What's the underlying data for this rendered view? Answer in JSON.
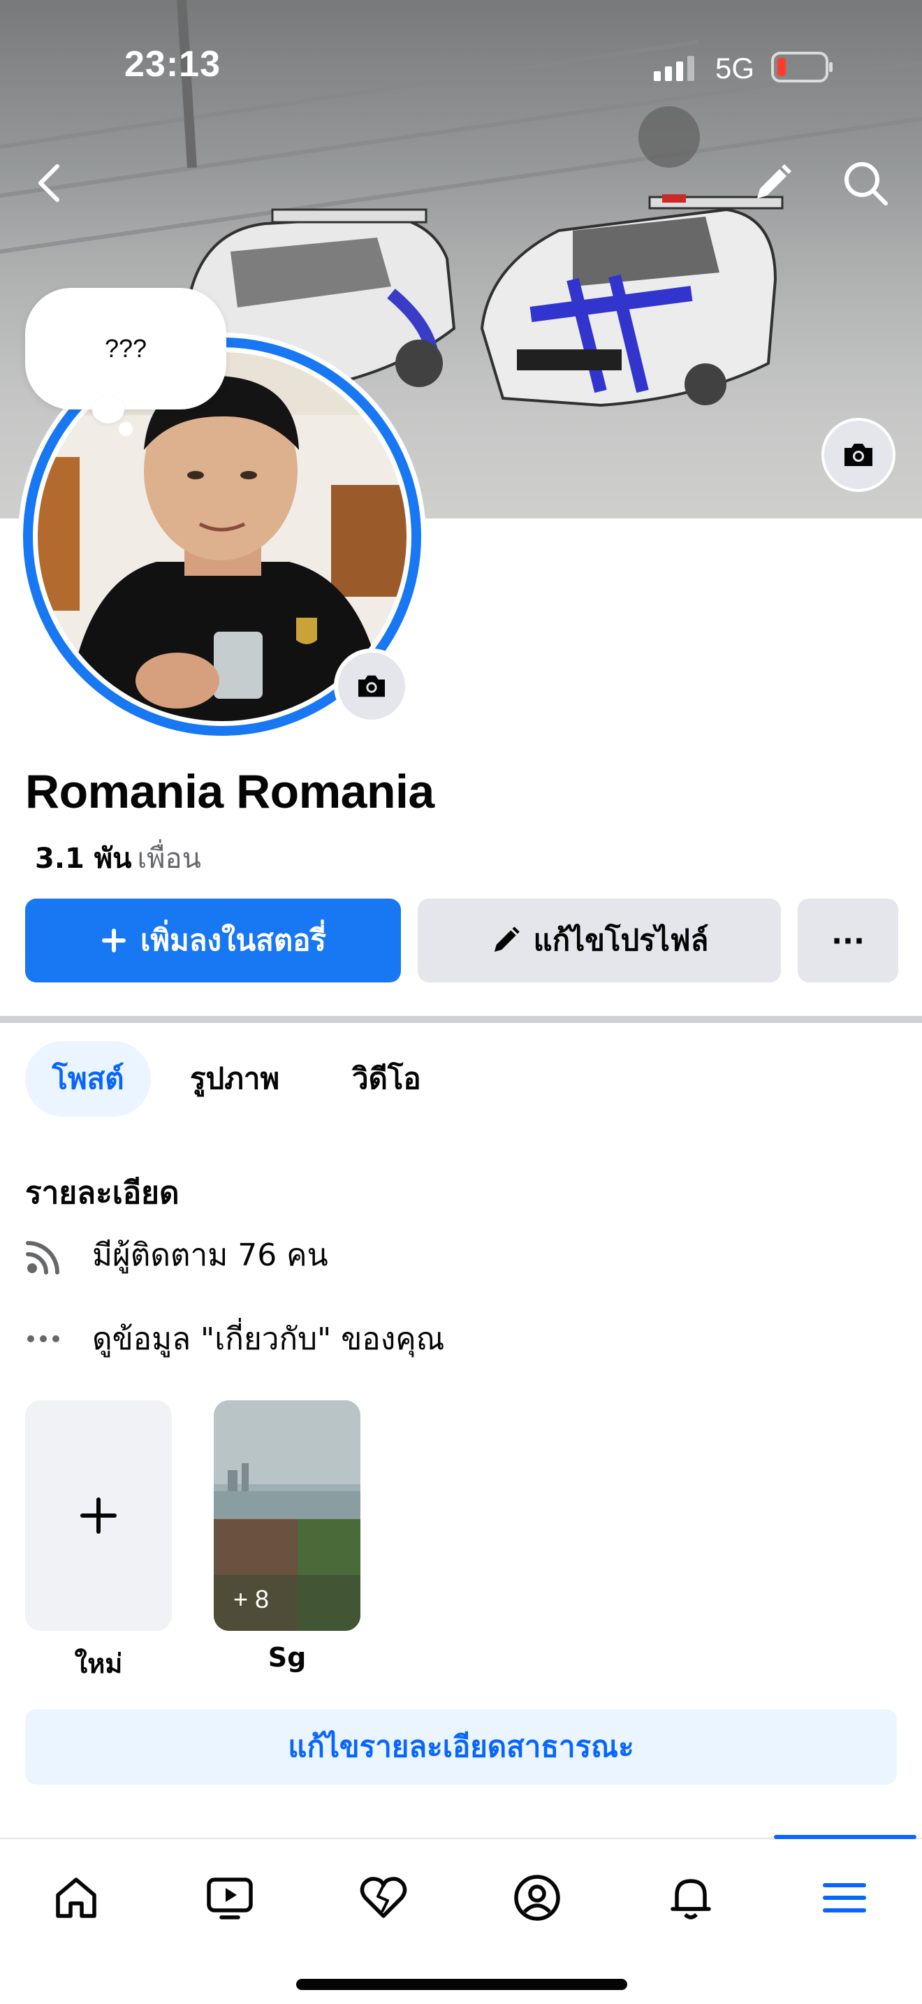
{
  "status_bar": {
    "time": "23:13",
    "network": "5G"
  },
  "note": {
    "text": "???"
  },
  "profile": {
    "name": "Romania Romania",
    "friends_count": "3.1 พัน",
    "friends_label": "เพื่อน"
  },
  "actions": {
    "add_story": "เพิ่มลงในสตอรี่",
    "edit_profile": "แก้ไขโปรไฟล์",
    "more": "···"
  },
  "tabs": [
    {
      "label": "โพสต์",
      "active": true
    },
    {
      "label": "รูปภาพ",
      "active": false
    },
    {
      "label": "วิดีโอ",
      "active": false
    }
  ],
  "details": {
    "title": "รายละเอียด",
    "followers": "มีผู้ติดตาม 76 คน",
    "about": "ดูข้อมูล \"เกี่ยวกับ\" ของคุณ"
  },
  "highlights": [
    {
      "label": "ใหม่"
    },
    {
      "label": "Sg",
      "count": "+ 8"
    }
  ],
  "edit_public_details": "แก้ไขรายละเอียดสาธารณะ",
  "bottom_nav": [
    {
      "icon": "home-icon"
    },
    {
      "icon": "video-icon"
    },
    {
      "icon": "dating-heart-icon"
    },
    {
      "icon": "profile-icon"
    },
    {
      "icon": "notifications-bell-icon"
    },
    {
      "icon": "menu-icon",
      "active": true
    }
  ],
  "colors": {
    "accent": "#1877f2",
    "accent_text": "#0866ff",
    "battery_low": "#ff3b30"
  }
}
